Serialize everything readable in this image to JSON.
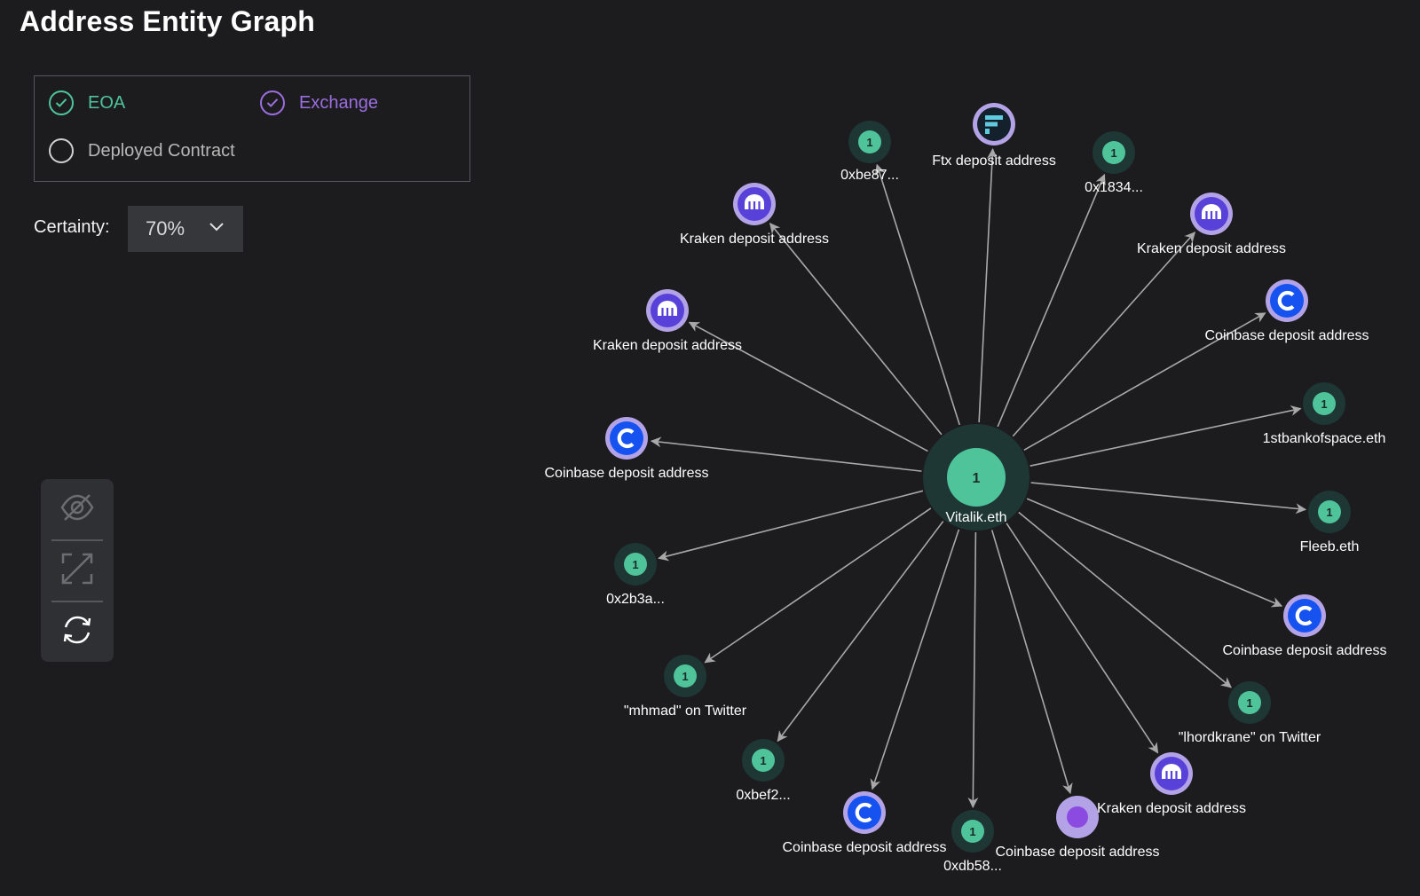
{
  "page": {
    "title": "Address Entity Graph"
  },
  "filters": {
    "eoa": {
      "label": "EOA",
      "checked": true,
      "color": "#4fc49a"
    },
    "exchange": {
      "label": "Exchange",
      "checked": true,
      "color": "#9b6ee0"
    },
    "deployed_contract": {
      "label": "Deployed Contract",
      "checked": false,
      "color": "#d0d0d0"
    }
  },
  "certainty": {
    "label": "Certainty:",
    "value": "70%"
  },
  "toolbar": {
    "buttons": [
      {
        "name": "hide-icon",
        "active": false
      },
      {
        "name": "expand-icon",
        "active": false
      },
      {
        "name": "refresh-icon",
        "active": true
      }
    ]
  },
  "colors": {
    "background": "#1c1c1e",
    "eoa_node": "#4fc49a",
    "eoa_halo": "#1e3634",
    "kraken": "#5741d9",
    "coinbase": "#1652f0",
    "exchange_ring": "#b3a3e6",
    "edge": "#a8a8a8"
  },
  "graph": {
    "center": {
      "label": "Vitalik.eth",
      "badge": "1",
      "type": "eoa"
    },
    "nodes": [
      {
        "label": "0xbe87...",
        "type": "eoa",
        "badge": "1"
      },
      {
        "label": "Ftx deposit address",
        "type": "ftx"
      },
      {
        "label": "0x1834...",
        "type": "eoa",
        "badge": "1"
      },
      {
        "label": "Kraken deposit address",
        "type": "kraken"
      },
      {
        "label": "Kraken deposit address",
        "type": "kraken"
      },
      {
        "label": "Kraken deposit address",
        "type": "kraken"
      },
      {
        "label": "Coinbase deposit address",
        "type": "coinbase"
      },
      {
        "label": "1stbankofspace.eth",
        "type": "eoa",
        "badge": "1"
      },
      {
        "label": "Coinbase deposit address",
        "type": "coinbase"
      },
      {
        "label": "Fleeb.eth",
        "type": "eoa",
        "badge": "1"
      },
      {
        "label": "0x2b3a...",
        "type": "eoa",
        "badge": "1"
      },
      {
        "label": "Coinbase deposit address",
        "type": "coinbase"
      },
      {
        "label": "\"mhmad\" on Twitter",
        "type": "eoa",
        "badge": "1"
      },
      {
        "label": "\"lhordkrane\" on Twitter",
        "type": "eoa",
        "badge": "1"
      },
      {
        "label": "0xbef2...",
        "type": "eoa",
        "badge": "1"
      },
      {
        "label": "Kraken deposit address",
        "type": "kraken"
      },
      {
        "label": "Coinbase deposit address",
        "type": "coinbase"
      },
      {
        "label": "0xdb58...",
        "type": "eoa",
        "badge": "1"
      },
      {
        "label": "Coinbase deposit address",
        "type": "purple"
      }
    ]
  }
}
